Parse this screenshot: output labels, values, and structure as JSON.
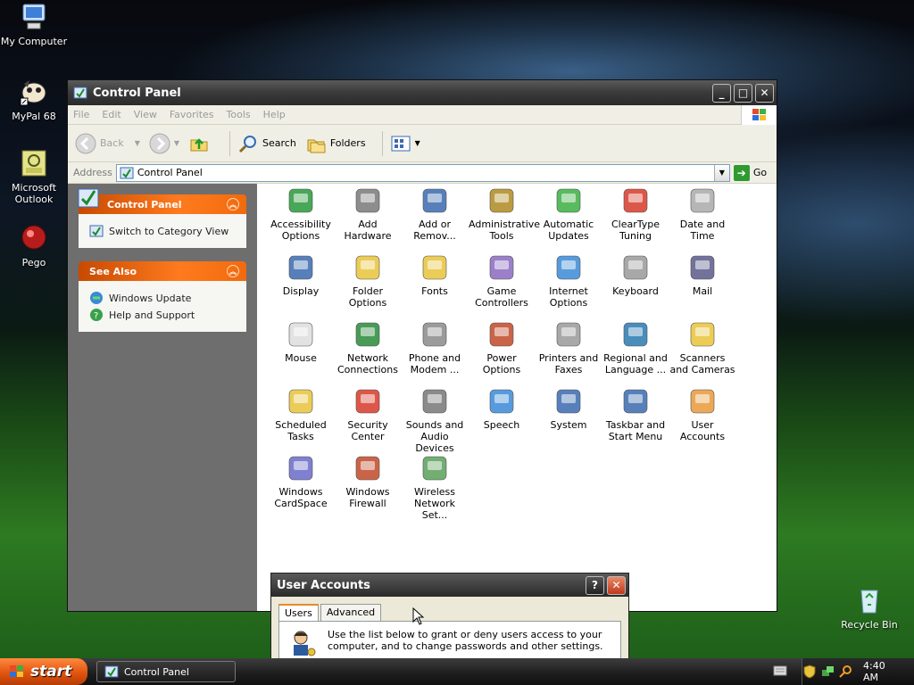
{
  "desktop": {
    "icons": [
      {
        "label": "My Computer"
      },
      {
        "label": "MyPal 68"
      },
      {
        "label": "Microsoft Outlook"
      },
      {
        "label": "Pego"
      },
      {
        "label": "Recycle Bin"
      }
    ]
  },
  "window": {
    "title": "Control Panel",
    "menu": [
      "File",
      "Edit",
      "View",
      "Favorites",
      "Tools",
      "Help"
    ],
    "toolbar": {
      "back": "Back",
      "search": "Search",
      "folders": "Folders"
    },
    "address": {
      "label": "Address",
      "value": "Control Panel",
      "go": "Go"
    }
  },
  "leftpane": {
    "control_panel": {
      "title": "Control Panel",
      "link": "Switch to Category View"
    },
    "see_also": {
      "title": "See Also",
      "links": [
        "Windows Update",
        "Help and Support"
      ]
    }
  },
  "items": [
    "Accessibility Options",
    "Add Hardware",
    "Add or Remov...",
    "Administrative Tools",
    "Automatic Updates",
    "ClearType Tuning",
    "Date and Time",
    "Display",
    "Folder Options",
    "Fonts",
    "Game Controllers",
    "Internet Options",
    "Keyboard",
    "Mail",
    "Mouse",
    "Network Connections",
    "Phone and Modem ...",
    "Power Options",
    "Printers and Faxes",
    "Regional and Language ...",
    "Scanners and Cameras",
    "Scheduled Tasks",
    "Security Center",
    "Sounds and Audio Devices",
    "Speech",
    "System",
    "Taskbar and Start Menu",
    "User Accounts",
    "Windows CardSpace",
    "Windows Firewall",
    "Wireless Network Set..."
  ],
  "dialog": {
    "title": "User Accounts",
    "tabs": [
      "Users",
      "Advanced"
    ],
    "text": "Use the list below to grant or deny users access to your computer, and to change passwords and other settings."
  },
  "taskbar": {
    "start": "start",
    "task": "Control Panel",
    "clock": "4:40 AM"
  },
  "colors": {
    "accent": "#e2540f",
    "panel_header": "#f26a0e"
  }
}
